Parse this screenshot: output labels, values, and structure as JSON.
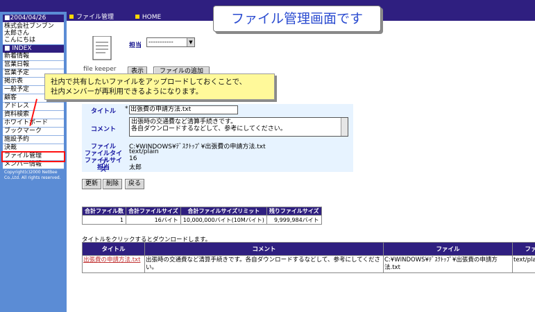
{
  "header": {
    "nav": [
      "ファイル管理",
      "HOME"
    ],
    "screen_title": "ファイル管理画面です"
  },
  "sidebar": {
    "date": "■2004/04/26",
    "company": "株式会社ブンブン",
    "user": "太郎さん",
    "greeting": "こんにちは",
    "index_label": "■ INDEX",
    "items": [
      {
        "label": "新着情報"
      },
      {
        "label": "営業日報"
      },
      {
        "label": "営業予定"
      },
      {
        "label": "掲示表"
      },
      {
        "label": "一般予定"
      },
      {
        "label": "顧客"
      },
      {
        "label": "アドレス"
      },
      {
        "label": "資料検索"
      },
      {
        "label": "ホワイトボード"
      },
      {
        "label": "ブックマーク"
      },
      {
        "label": "施設予約"
      },
      {
        "label": "決裁"
      },
      {
        "label": "ファイル管理"
      },
      {
        "label": "メンバー情報"
      }
    ],
    "selected_item": "ファイル管理",
    "copyright": "Copyright(c)2000 NetBee Co.,Ltd. All rights reserved."
  },
  "toolbar": {
    "logo_label": "file keeper",
    "tanto_label": "担当",
    "tanto_value": "-----------",
    "display_button": "表示",
    "add_file_button": "ファイルの追加"
  },
  "note": {
    "line1": "社内で共有したいファイルをアップロードしておくことで、",
    "line2": "社内メンバーが再利用できるようになります。"
  },
  "form": {
    "title_label": "タイトル",
    "title_value": "出張費の申請方法.txt",
    "required_mark": "*",
    "comment_label": "コメント",
    "comment_line1": "出張時の交通費など清算手続きです。",
    "comment_line2": "各自ダウンロードするなどして、参考にしてください。",
    "file_label": "ファイル",
    "file_value": "C:¥WINDOWS¥ﾃﾞｽｸﾄｯﾌﾟ¥出張費の申請方法.txt",
    "filetype_label": "ファイルタイプ",
    "filetype_value": "text/plain",
    "filesize_label": "ファイルサイズ",
    "filesize_value": "16",
    "tanto_label": "担当",
    "tanto_value": "太郎"
  },
  "actions": {
    "update": "更新",
    "delete": "削除",
    "back": "戻る"
  },
  "summary": {
    "headers": [
      "合計ファイル数",
      "合計ファイルサイズ",
      "合計ファイルサイズリミット",
      "残りファイルサイズ"
    ],
    "values": [
      "1",
      "16バイト",
      "10,000,000バイト(10Mバイト)",
      "9,999,984バイト"
    ]
  },
  "list": {
    "hint": "タイトルをクリックするとダウンロードします。",
    "headers": [
      "タイトル",
      "コメント",
      "ファイル",
      "ファイル"
    ],
    "rows": [
      {
        "title": "出張費の申請方法.txt",
        "comment": "出張時の交通費など清算手続きです。各自ダウンロードするなどして、参考にしてください。",
        "file": "C:¥WINDOWS¥ﾃﾞｽｸﾄｯﾌﾟ¥出張費の申請方法.txt",
        "filetype": "text/plain"
      }
    ]
  },
  "colors": {
    "header_bg": "#2f1f80",
    "sidebar_bg": "#5b8cd5",
    "highlight": "#ff1010",
    "note_bg": "#fff99a",
    "title_text": "#2a4bd0"
  }
}
